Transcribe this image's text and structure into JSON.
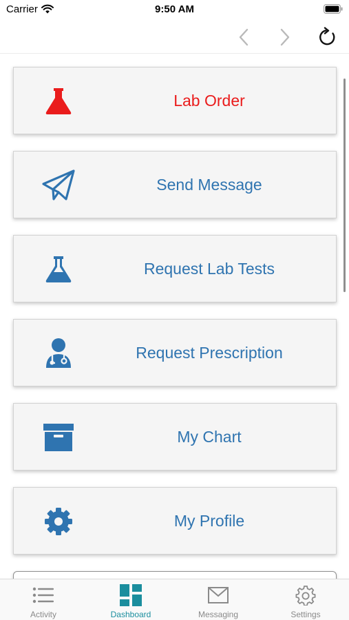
{
  "status_bar": {
    "carrier": "Carrier",
    "time": "9:50 AM"
  },
  "nav": {
    "back_icon": "chevron-left-icon",
    "forward_icon": "chevron-right-icon",
    "reload_icon": "reload-icon"
  },
  "menu": [
    {
      "label": "Lab Order",
      "icon": "flask-icon",
      "color": "#ea1c1c"
    },
    {
      "label": "Send Message",
      "icon": "paper-plane-icon",
      "color": "#2f74b0"
    },
    {
      "label": "Request Lab Tests",
      "icon": "flask-icon",
      "color": "#2f74b0"
    },
    {
      "label": "Request Prescription",
      "icon": "doctor-icon",
      "color": "#2f74b0"
    },
    {
      "label": "My Chart",
      "icon": "archive-box-icon",
      "color": "#2f74b0"
    },
    {
      "label": "My Profile",
      "icon": "gear-icon",
      "color": "#2f74b0"
    }
  ],
  "tabs": [
    {
      "label": "Activity",
      "icon": "list-icon",
      "active": false
    },
    {
      "label": "Dashboard",
      "icon": "dashboard-icon",
      "active": true
    },
    {
      "label": "Messaging",
      "icon": "envelope-icon",
      "active": false
    },
    {
      "label": "Settings",
      "icon": "gear-icon",
      "active": false
    }
  ],
  "colors": {
    "accent": "#2f74b0",
    "highlight": "#ea1c1c",
    "tab_active": "#1b8e9e",
    "tab_inactive": "#8a8a8a"
  }
}
